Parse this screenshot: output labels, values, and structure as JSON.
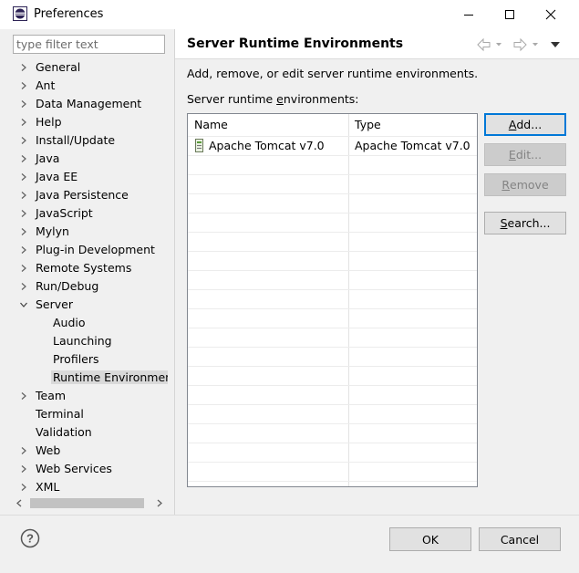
{
  "window": {
    "title": "Preferences"
  },
  "filter": {
    "placeholder": "type filter text",
    "value": ""
  },
  "tree": [
    {
      "label": "General",
      "expander": "collapsed",
      "level": 0
    },
    {
      "label": "Ant",
      "expander": "collapsed",
      "level": 0
    },
    {
      "label": "Data Management",
      "expander": "collapsed",
      "level": 0
    },
    {
      "label": "Help",
      "expander": "collapsed",
      "level": 0
    },
    {
      "label": "Install/Update",
      "expander": "collapsed",
      "level": 0
    },
    {
      "label": "Java",
      "expander": "collapsed",
      "level": 0
    },
    {
      "label": "Java EE",
      "expander": "collapsed",
      "level": 0
    },
    {
      "label": "Java Persistence",
      "expander": "collapsed",
      "level": 0
    },
    {
      "label": "JavaScript",
      "expander": "collapsed",
      "level": 0
    },
    {
      "label": "Mylyn",
      "expander": "collapsed",
      "level": 0
    },
    {
      "label": "Plug-in Development",
      "expander": "collapsed",
      "level": 0
    },
    {
      "label": "Remote Systems",
      "expander": "collapsed",
      "level": 0
    },
    {
      "label": "Run/Debug",
      "expander": "collapsed",
      "level": 0
    },
    {
      "label": "Server",
      "expander": "expanded",
      "level": 0
    },
    {
      "label": "Audio",
      "expander": "none",
      "level": 1
    },
    {
      "label": "Launching",
      "expander": "none",
      "level": 1
    },
    {
      "label": "Profilers",
      "expander": "none",
      "level": 1
    },
    {
      "label": "Runtime Environment",
      "expander": "none",
      "level": 1,
      "selected": true
    },
    {
      "label": "Team",
      "expander": "collapsed",
      "level": 0
    },
    {
      "label": "Terminal",
      "expander": "none",
      "level": 0
    },
    {
      "label": "Validation",
      "expander": "none",
      "level": 0
    },
    {
      "label": "Web",
      "expander": "collapsed",
      "level": 0
    },
    {
      "label": "Web Services",
      "expander": "collapsed",
      "level": 0
    },
    {
      "label": "XML",
      "expander": "collapsed",
      "level": 0
    }
  ],
  "page": {
    "title": "Server Runtime Environments",
    "description": "Add, remove, or edit server runtime environments.",
    "table_label": {
      "before": "Server runtime ",
      "mnemonic": "e",
      "after": "nvironments:"
    },
    "columns": [
      "Name",
      "Type"
    ],
    "rows": [
      {
        "name": "Apache Tomcat v7.0",
        "type": "Apache Tomcat v7.0",
        "icon": "server-runtime-icon"
      }
    ]
  },
  "buttons": {
    "add": {
      "mnemonic": "A",
      "rest": "dd...",
      "enabled": true
    },
    "edit": {
      "mnemonic": "E",
      "rest": "dit...",
      "enabled": false
    },
    "remove": {
      "mnemonic": "R",
      "rest": "emove",
      "enabled": false
    },
    "search": {
      "mnemonic": "S",
      "rest": "earch...",
      "enabled": true
    }
  },
  "footer": {
    "ok": "OK",
    "cancel": "Cancel"
  },
  "icons": {
    "app": "eclipse-icon",
    "minimize": "minimize-icon",
    "maximize": "maximize-icon",
    "close": "close-icon",
    "back": "back-arrow-icon",
    "forward": "forward-arrow-icon",
    "menu": "view-menu-icon",
    "help": "help-icon"
  },
  "colors": {
    "selection": "#d9d9d9",
    "focus_border": "#0078d7",
    "disabled_text": "#838383"
  }
}
